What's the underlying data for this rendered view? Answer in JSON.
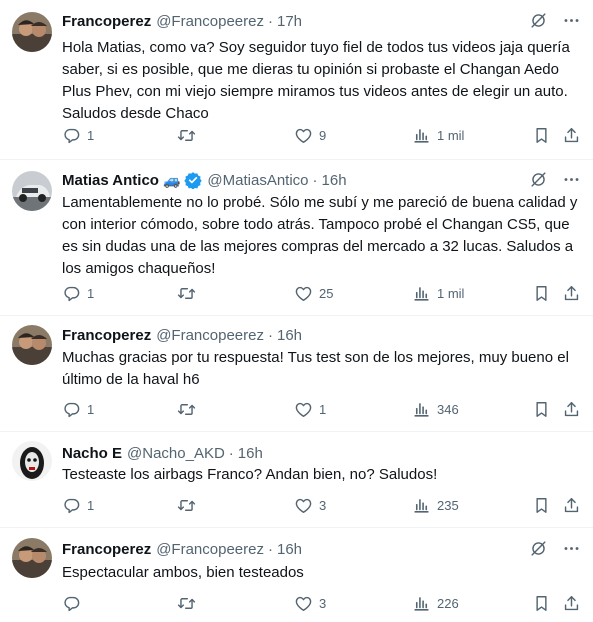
{
  "tweets": [
    {
      "name": "Francoperez",
      "handle": "@Francopeerez",
      "sep": "·",
      "time": "17h",
      "text": "Hola Matias, como va? Soy seguidor tuyo fiel de todos tus videos jaja quería saber, si es posible, que me dieras tu opinión si probaste el Changan Aedo Plus Phev, con mi viejo siempre miramos tus videos antes de elegir un auto. Saludos desde Chaco",
      "replies": "1",
      "retweets": "",
      "likes": "9",
      "views": "1 mil"
    },
    {
      "name": "Matias Antico",
      "emoji": "🚙",
      "verified": true,
      "handle": "@MatiasAntico",
      "sep": "·",
      "time": "16h",
      "text": "Lamentablemente no lo probé. Sólo me subí y me pareció de buena calidad y con interior cómodo, sobre todo atrás. Tampoco probé el Changan CS5, que es sin dudas una de las mejores compras del mercado a 32 lucas. Saludos a los amigos chaqueños!",
      "replies": "1",
      "retweets": "",
      "likes": "25",
      "views": "1 mil"
    },
    {
      "name": "Francoperez",
      "handle": "@Francopeerez",
      "sep": "·",
      "time": "16h",
      "text": "Muchas gracias por tu respuesta! Tus test son de los mejores, muy bueno el último de la haval h6",
      "replies": "1",
      "retweets": "",
      "likes": "1",
      "views": "346"
    },
    {
      "name": "Nacho E",
      "handle": "@Nacho_AKD",
      "sep": "·",
      "time": "16h",
      "text": "Testeaste los airbags Franco? Andan bien, no? Saludos!",
      "replies": "1",
      "retweets": "",
      "likes": "3",
      "views": "235"
    },
    {
      "name": "Francoperez",
      "handle": "@Francopeerez",
      "sep": "·",
      "time": "16h",
      "text": "Espectacular ambos, bien testeados",
      "replies": "",
      "retweets": "",
      "likes": "3",
      "views": "226"
    }
  ],
  "icons": {
    "reply": "reply-icon",
    "retweet": "retweet-icon",
    "like": "heart-icon",
    "views": "views-icon",
    "bookmark": "bookmark-icon",
    "share": "share-icon",
    "grok": "grok-icon",
    "more": "more-icon",
    "verified": "verified-badge-icon"
  },
  "colors": {
    "text": "#0f1419",
    "muted": "#536471",
    "verified": "#1d9bf0",
    "divider": "#eff3f4"
  }
}
